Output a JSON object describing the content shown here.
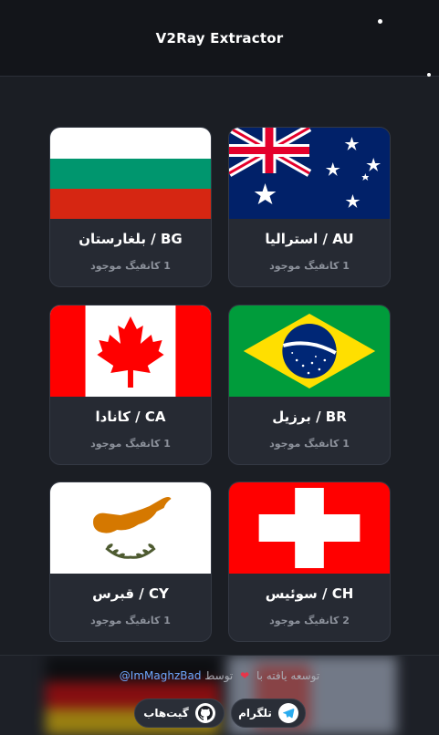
{
  "header": {
    "title": "V2Ray Extractor"
  },
  "cards": [
    {
      "code_name": "BG / بلغارستان",
      "count": "1 کانفیگ موجود"
    },
    {
      "code_name": "AU / استرالیا",
      "count": "1 کانفیگ موجود"
    },
    {
      "code_name": "CA / کانادا",
      "count": "1 کانفیگ موجود"
    },
    {
      "code_name": "BR / برزیل",
      "count": "1 کانفیگ موجود"
    },
    {
      "code_name": "CY / قبرس",
      "count": "1 کانفیگ موجود"
    },
    {
      "code_name": "CH / سوئیس",
      "count": "2 کانفیگ موجود"
    }
  ],
  "footer": {
    "credit_prefix": "توسعه یافته با",
    "credit_by": "توسط",
    "handle": "@ImMaghzBad",
    "telegram_label": "تلگرام",
    "github_label": "گیت‌هاب"
  },
  "colors": {
    "accent_link": "#6ea8fe",
    "heart": "#e8354a",
    "card_bg": "#262a33"
  }
}
